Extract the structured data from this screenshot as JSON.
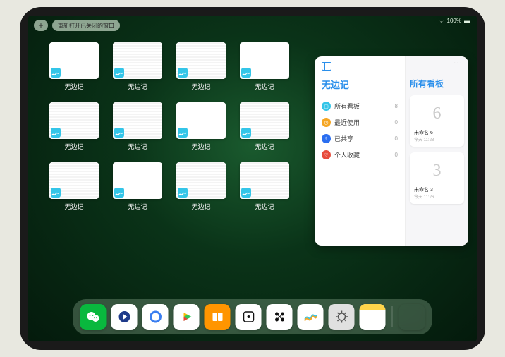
{
  "status": {
    "signal": "●●●●",
    "battery_text": "100%"
  },
  "toolbar": {
    "plus": "+",
    "reopen_label": "重新打开已关闭的窗口"
  },
  "app_switcher": {
    "app_icon_name": "freeform-icon",
    "app_label": "无边记",
    "cards": [
      {
        "kind": "blank"
      },
      {
        "kind": "calendar"
      },
      {
        "kind": "calendar"
      },
      {
        "kind": "blank"
      },
      {
        "kind": "calendar"
      },
      {
        "kind": "calendar"
      },
      {
        "kind": "blank"
      },
      {
        "kind": "calendar"
      },
      {
        "kind": "calendar"
      },
      {
        "kind": "blank"
      },
      {
        "kind": "calendar"
      },
      {
        "kind": "calendar"
      }
    ]
  },
  "panel": {
    "ellipsis": "···",
    "left_title": "无边记",
    "right_title": "所有看板",
    "items": [
      {
        "icon_color": "#34c5e8",
        "glyph": "▢",
        "label": "所有看板",
        "count": "8"
      },
      {
        "icon_color": "#f5a623",
        "glyph": "◷",
        "label": "最近使用",
        "count": "0"
      },
      {
        "icon_color": "#2a6ef0",
        "glyph": "⇪",
        "label": "已共享",
        "count": "0"
      },
      {
        "icon_color": "#e74c3c",
        "glyph": "♡",
        "label": "个人收藏",
        "count": "0"
      }
    ],
    "boards": [
      {
        "sketch": "6",
        "title": "未命名 6",
        "subtitle": "今天 11:28"
      },
      {
        "sketch": "3",
        "title": "未命名 3",
        "subtitle": "今天 11:26"
      }
    ]
  },
  "dock": {
    "icons": [
      {
        "name": "wechat-icon",
        "bg": "#09b83e",
        "type": "wechat"
      },
      {
        "name": "tencent-video-icon",
        "bg": "#ffffff",
        "type": "tvideo"
      },
      {
        "name": "quark-icon",
        "bg": "#ffffff",
        "type": "quark"
      },
      {
        "name": "play-app-icon",
        "bg": "#ffffff",
        "type": "play"
      },
      {
        "name": "books-icon",
        "bg": "#ff9500",
        "type": "books"
      },
      {
        "name": "dice-icon",
        "bg": "#ffffff",
        "type": "dice"
      },
      {
        "name": "connect-icon",
        "bg": "#ffffff",
        "type": "connect"
      },
      {
        "name": "freeform-icon",
        "bg": "#ffffff",
        "type": "freeform"
      },
      {
        "name": "settings-icon",
        "bg": "#e0e0e0",
        "type": "gear"
      },
      {
        "name": "notes-icon",
        "bg": "#ffffff",
        "type": "notes"
      },
      {
        "name": "app-library-icon",
        "bg": "transparent",
        "type": "grid"
      }
    ]
  }
}
